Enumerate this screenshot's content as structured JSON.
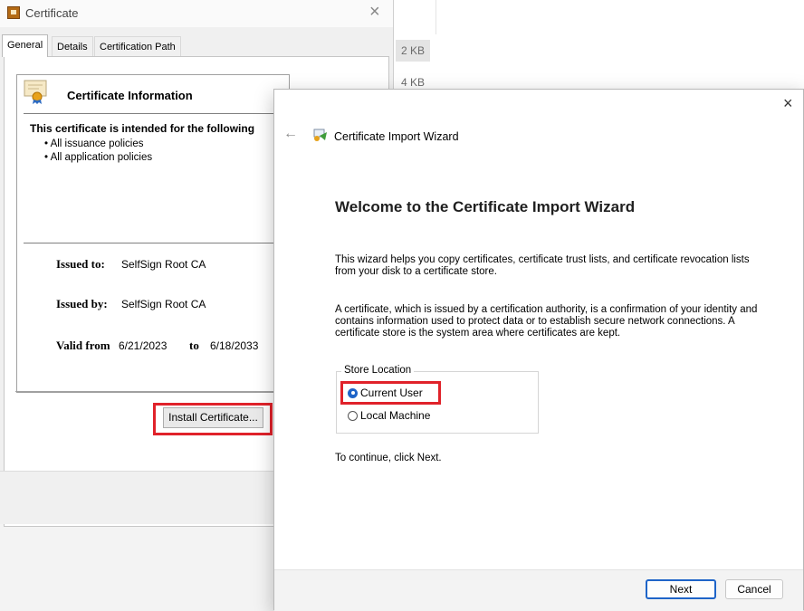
{
  "background": {
    "sizes": [
      "2 KB",
      "4 KB"
    ]
  },
  "certificate_dialog": {
    "title": "Certificate",
    "close": "×",
    "tabs": [
      "General",
      "Details",
      "Certification Path"
    ],
    "info_title": "Certificate Information",
    "intended": "This certificate is intended for the following",
    "policies": [
      "• All issuance policies",
      "• All application policies"
    ],
    "issued_to_label": "Issued to:",
    "issued_to": "SelfSign Root CA",
    "issued_by_label": "Issued by:",
    "issued_by": "SelfSign Root CA",
    "valid_from_label": "Valid from",
    "valid_from": "6/21/2023",
    "valid_to_label": "to",
    "valid_to": "6/18/2033",
    "install_button": "Install Certificate..."
  },
  "wizard": {
    "close": "×",
    "back": "←",
    "title": "Certificate Import Wizard",
    "heading": "Welcome to the Certificate Import Wizard",
    "para1": "This wizard helps you copy certificates, certificate trust lists, and certificate revocation lists from your disk to a certificate store.",
    "para2": "A certificate, which is issued by a certification authority, is a confirmation of your identity and contains information used to protect data or to establish secure network connections. A certificate store is the system area where certificates are kept.",
    "store_location_label": "Store Location",
    "options": [
      "Current User",
      "Local Machine"
    ],
    "selected": "Current User",
    "continue_text": "To continue, click Next.",
    "next_button": "Next",
    "cancel_button": "Cancel"
  },
  "colors": {
    "highlight": "#e0222a",
    "accent": "#1e64c8"
  }
}
